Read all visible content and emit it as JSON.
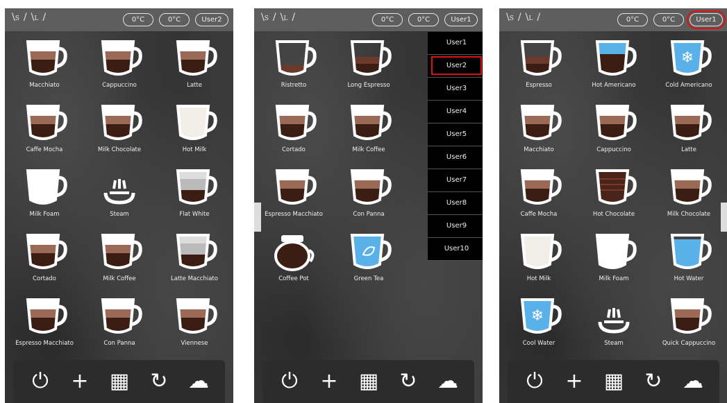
{
  "sizes": [
    "S",
    "L"
  ],
  "screens": [
    {
      "temp1": "0°C",
      "temp2": "0°C",
      "user": "User2",
      "user_highlight": false,
      "drinks": [
        {
          "label": "Macchiato",
          "icon": "macchiato-icon"
        },
        {
          "label": "Cappuccino",
          "icon": "cappuccino-icon"
        },
        {
          "label": "Latte",
          "icon": "latte-icon"
        },
        {
          "label": "Caffe Mocha",
          "icon": "caffe-mocha-icon"
        },
        {
          "label": "Milk Chocolate",
          "icon": "milk-chocolate-icon"
        },
        {
          "label": "Hot Milk",
          "icon": "hot-milk-icon"
        },
        {
          "label": "Milk Foam",
          "icon": "milk-foam-icon"
        },
        {
          "label": "Steam",
          "icon": "steam-icon"
        },
        {
          "label": "Flat White",
          "icon": "flat-white-icon"
        },
        {
          "label": "Cortado",
          "icon": "cortado-icon"
        },
        {
          "label": "Milk Coffee",
          "icon": "milk-coffee-icon"
        },
        {
          "label": "Latte Macchiato",
          "icon": "latte-macchiato-icon"
        },
        {
          "label": "Espresso Macchiato",
          "icon": "espresso-macchiato-icon"
        },
        {
          "label": "Con Panna",
          "icon": "con-panna-icon"
        },
        {
          "label": "Viennese",
          "icon": "viennese-icon"
        }
      ]
    },
    {
      "temp1": "0°C",
      "temp2": "0°C",
      "user": "User1",
      "user_highlight": false,
      "drinks": [
        {
          "label": "Ristretto",
          "icon": "ristretto-icon"
        },
        {
          "label": "Long Espresso",
          "icon": "long-espresso-icon"
        },
        {
          "label": "",
          "icon": ""
        },
        {
          "label": "Cortado",
          "icon": "cortado-icon"
        },
        {
          "label": "Milk Coffee",
          "icon": "milk-coffee-icon"
        },
        {
          "label": "",
          "icon": ""
        },
        {
          "label": "Espresso Macchiato",
          "icon": "espresso-macchiato-icon"
        },
        {
          "label": "Con Panna",
          "icon": "con-panna-icon"
        },
        {
          "label": "",
          "icon": ""
        },
        {
          "label": "Coffee Pot",
          "icon": "coffee-pot-icon"
        },
        {
          "label": "Green Tea",
          "icon": "green-tea-icon"
        }
      ],
      "dropdown": [
        "User1",
        "User2",
        "User3",
        "User4",
        "User5",
        "User6",
        "User7",
        "User8",
        "User9",
        "User10"
      ],
      "dropdown_selected": "User2"
    },
    {
      "temp1": "0°C",
      "temp2": "0°C",
      "user": "User1",
      "user_highlight": true,
      "drinks": [
        {
          "label": "Espresso",
          "icon": "espresso-icon"
        },
        {
          "label": "Hot Americano",
          "icon": "hot-americano-icon"
        },
        {
          "label": "Cold Americano",
          "icon": "cold-americano-icon"
        },
        {
          "label": "Macchiato",
          "icon": "macchiato-icon"
        },
        {
          "label": "Cappuccino",
          "icon": "cappuccino-icon"
        },
        {
          "label": "Latte",
          "icon": "latte-icon"
        },
        {
          "label": "Caffe Mocha",
          "icon": "caffe-mocha-icon"
        },
        {
          "label": "Hot Chocolate",
          "icon": "hot-chocolate-icon"
        },
        {
          "label": "Milk Chocolate",
          "icon": "milk-chocolate-icon"
        },
        {
          "label": "Hot Milk",
          "icon": "hot-milk-icon"
        },
        {
          "label": "Milk Foam",
          "icon": "milk-foam-icon"
        },
        {
          "label": "Hot Water",
          "icon": "hot-water-icon"
        },
        {
          "label": "Cool Water",
          "icon": "cool-water-icon"
        },
        {
          "label": "Steam",
          "icon": "steam-icon"
        },
        {
          "label": "Quick Cappuccino",
          "icon": "quick-cappuccino-icon"
        }
      ]
    }
  ],
  "bottom_icons": [
    "power-icon",
    "plus-icon",
    "grid-icon",
    "rinse-icon",
    "clean-icon"
  ],
  "colors": {
    "highlight": "#dd1111",
    "coffee": "#3b1d14",
    "water": "#4aa3df"
  }
}
